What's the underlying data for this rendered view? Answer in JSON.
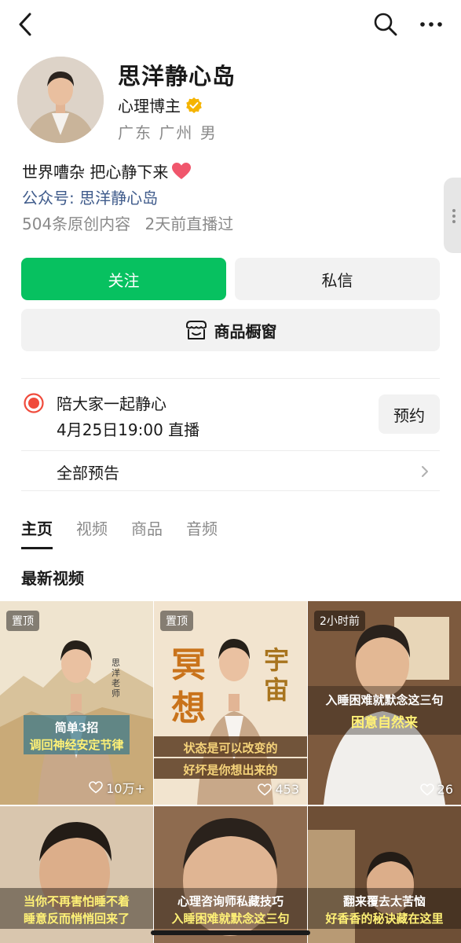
{
  "profile": {
    "name": "思洋静心岛",
    "role": "心理博主",
    "location": "广东 广州 男",
    "bio": "世界嘈杂 把心静下来",
    "official_account": "公众号: 思洋静心岛",
    "stats": [
      "504条原创内容",
      "2天前直播过"
    ]
  },
  "actions": {
    "follow": "关注",
    "message": "私信",
    "shop": "商品橱窗"
  },
  "live": {
    "title": "陪大家一起静心",
    "time": "4月25日19:00 直播",
    "reserve": "预约",
    "all_preview": "全部预告"
  },
  "tabs": [
    {
      "label": "主页",
      "active": true
    },
    {
      "label": "视频",
      "active": false
    },
    {
      "label": "商品",
      "active": false
    },
    {
      "label": "音频",
      "active": false
    }
  ],
  "section_title": "最新视频",
  "videos": [
    {
      "badge": "置顶",
      "likes": "10万+",
      "caption_lines": [
        "简单3招",
        "调回神经安定节律"
      ],
      "side_text": "思洋老师",
      "icon": "heart-outline-icon"
    },
    {
      "badge": "置顶",
      "likes": "453",
      "caption_lines": [
        "状态是可以改变的",
        "好坏是你想出来的"
      ],
      "big_text": [
        "冥",
        "想",
        "宇",
        "宙"
      ],
      "icon": "heart-outline-icon"
    },
    {
      "badge": "2小时前",
      "likes": "26",
      "caption_lines": [
        "入睡困难就默念这三句",
        "困意自然来"
      ],
      "icon": "heart-outline-icon"
    },
    {
      "caption_lines": [
        "当你不再害怕睡不着",
        "睡意反而悄悄回来了"
      ]
    },
    {
      "caption_lines": [
        "心理咨询师私藏技巧",
        "入睡困难就默念这三句"
      ]
    },
    {
      "caption_lines": [
        "翻来覆去太苦恼",
        "好香香的秘诀藏在这里"
      ]
    }
  ],
  "colors": {
    "accent_green": "#07c160",
    "link_blue": "#3f5b8b",
    "verified_gold": "#f5b400",
    "live_red": "#f04b3c"
  }
}
